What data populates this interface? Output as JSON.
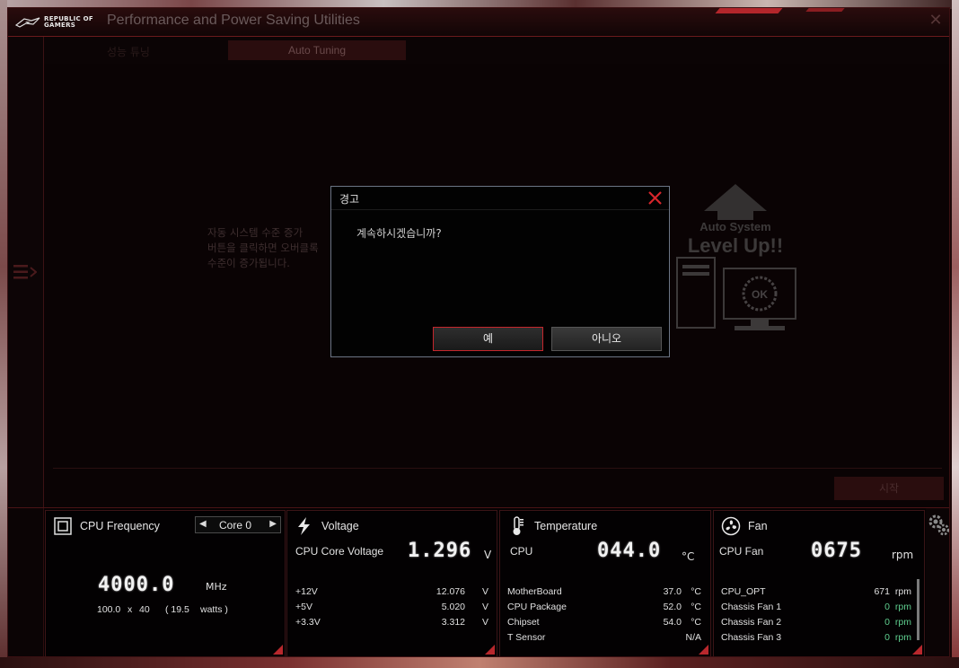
{
  "app": {
    "logo_text_line1": "REPUBLIC OF",
    "logo_text_line2": "GAMERS",
    "title": "Performance and Power Saving Utilities"
  },
  "tabs": {
    "left_label": "성능 튜닝",
    "auto_label": "Auto Tuning"
  },
  "content": {
    "desc_line1": "자동 시스템 수준 증가",
    "desc_line2": "버튼을 클릭하면 오버클록",
    "desc_line3": "수준이 증가됩니다.",
    "graphic_line1": "Auto System",
    "graphic_line2": "Level Up!!",
    "graphic_ok": "OK",
    "start_label": "시작"
  },
  "dialog": {
    "title": "경고",
    "message": "계속하시겠습니까?",
    "yes_label": "예",
    "no_label": "아니오"
  },
  "cpu_freq": {
    "title": "CPU Frequency",
    "core_select": "Core 0",
    "value": "4000.0",
    "unit": "MHz",
    "bclk": "100.0",
    "x": "x",
    "ratio": "40",
    "watts_open": "( 19.5",
    "watts_unit": "watts )"
  },
  "voltage": {
    "title": "Voltage",
    "main_label": "CPU Core Voltage",
    "main_value": "1.296",
    "main_unit": "V",
    "rows": [
      {
        "label": "+12V",
        "value": "12.076",
        "unit": "V"
      },
      {
        "label": "+5V",
        "value": "5.020",
        "unit": "V"
      },
      {
        "label": "+3.3V",
        "value": "3.312",
        "unit": "V"
      }
    ]
  },
  "temperature": {
    "title": "Temperature",
    "main_label": "CPU",
    "main_value": "044.0",
    "main_unit": "°C",
    "rows": [
      {
        "label": "MotherBoard",
        "value": "37.0",
        "unit": "°C"
      },
      {
        "label": "CPU Package",
        "value": "52.0",
        "unit": "°C"
      },
      {
        "label": "Chipset",
        "value": "54.0",
        "unit": "°C"
      },
      {
        "label": "T Sensor",
        "value": "N/A",
        "unit": ""
      }
    ]
  },
  "fan": {
    "title": "Fan",
    "main_label": "CPU Fan",
    "main_value": "0675",
    "main_unit": "rpm",
    "rows": [
      {
        "label": "CPU_OPT",
        "value": "671",
        "unit": "rpm"
      },
      {
        "label": "Chassis Fan 1",
        "value": "0",
        "unit": "rpm"
      },
      {
        "label": "Chassis Fan 2",
        "value": "0",
        "unit": "rpm"
      },
      {
        "label": "Chassis Fan 3",
        "value": "0",
        "unit": "rpm"
      }
    ]
  },
  "colors": {
    "accent_red": "#b8282d",
    "green_value": "#5fcf8f",
    "dialog_border": "#6b7585"
  }
}
